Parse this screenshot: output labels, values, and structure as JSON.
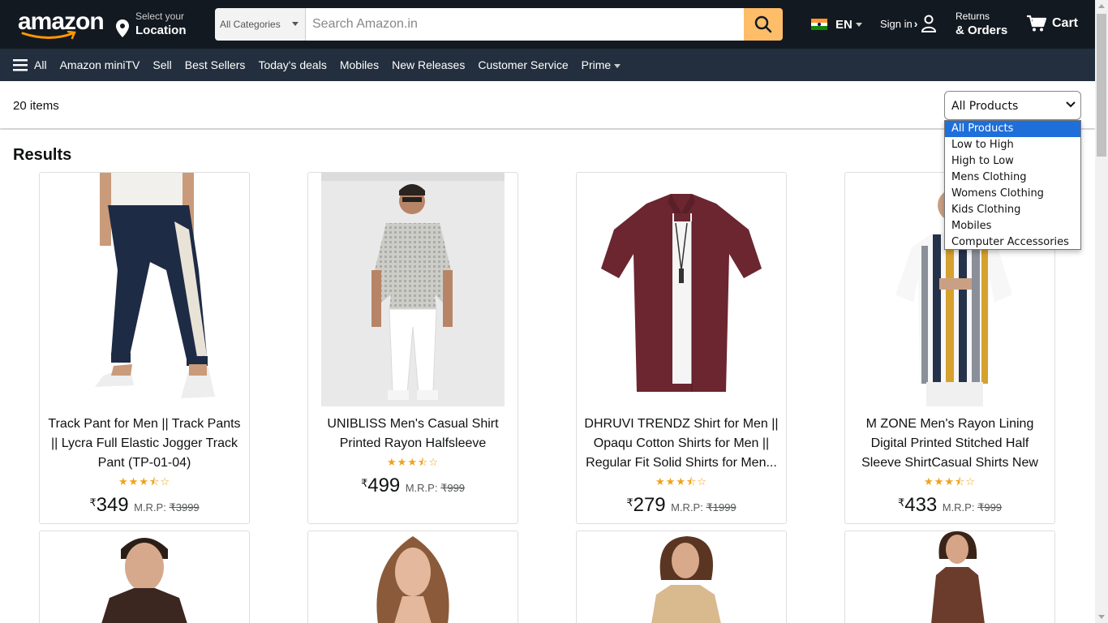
{
  "header": {
    "logo_text": "amazon",
    "logo_tld": ".in",
    "location_line1": "Select your",
    "location_line2": "Location",
    "search_category": "All Categories",
    "search_placeholder": "Search Amazon.in",
    "language": "EN",
    "signin_label": "Sign in",
    "returns_line1": "Returns",
    "returns_line2": "& Orders",
    "cart_label": "Cart"
  },
  "subnav": {
    "all_label": "All",
    "links": [
      "Amazon miniTV",
      "Sell",
      "Best Sellers",
      "Today's deals",
      "Mobiles",
      "New Releases",
      "Customer Service"
    ],
    "prime_label": "Prime"
  },
  "toolbar": {
    "item_count": "20 items",
    "sort_selected": "All Products",
    "sort_options": [
      "All Products",
      "Low to High",
      "High to Low",
      "Mens Clothing",
      "Womens Clothing",
      "Kids Clothing",
      "Mobiles",
      "Computer Accessories"
    ]
  },
  "results": {
    "title": "Results",
    "products": [
      {
        "title": "Track Pant for Men || Track Pants || Lycra Full Elastic Jogger Track Pant (TP-01-04)",
        "rating": 3.5,
        "currency": "₹",
        "price": "349",
        "mrp_label": "M.R.P:",
        "mrp": "₹3999"
      },
      {
        "title": "UNIBLISS Men's Casual Shirt Printed Rayon Halfsleeve",
        "rating": 3.5,
        "currency": "₹",
        "price": "499",
        "mrp_label": "M.R.P:",
        "mrp": "₹999"
      },
      {
        "title": "DHRUVI TRENDZ Shirt for Men || Opaqu Cotton Shirts for Men || Regular Fit Solid Shirts for Men...",
        "rating": 3.5,
        "currency": "₹",
        "price": "279",
        "mrp_label": "M.R.P:",
        "mrp": "₹1999"
      },
      {
        "title": "M ZONE Men's Rayon Lining Digital Printed Stitched Half Sleeve ShirtCasual Shirts New",
        "rating": 3.5,
        "currency": "₹",
        "price": "433",
        "mrp_label": "M.R.P:",
        "mrp": "₹999"
      }
    ]
  },
  "colors": {
    "nav_dark": "#131921",
    "nav_sub": "#232f3e",
    "search_button": "#febd69",
    "star": "#f0a21c",
    "dropdown_selected": "#1e6fd9"
  },
  "icons": [
    "location-pin-icon",
    "search-icon",
    "india-flag-icon",
    "user-icon",
    "cart-icon",
    "hamburger-icon",
    "star-icon",
    "chevron-down-icon"
  ]
}
